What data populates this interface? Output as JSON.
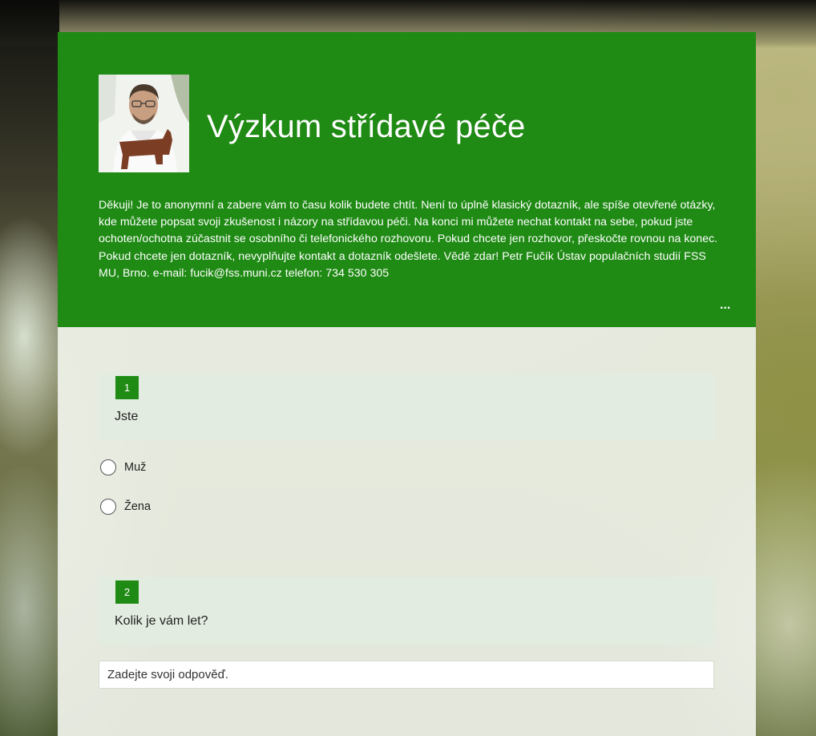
{
  "form": {
    "title": "Výzkum střídavé péče",
    "description": "Děkuji! Je to anonymní a zabere vám to času kolik budete chtít. Není to úplně klasický dotazník, ale spíše otevřené otázky, kde můžete popsat svoji zkušenost i názory na střídavou péči. Na konci mi můžete nechat kontakt na sebe, pokud jste ochoten/ochotna zúčastnit se osobního či telefonického rozhovoru. Pokud chcete jen rozhovor, přeskočte rovnou na konec. Pokud chcete jen dotazník, nevyplňujte kontakt a dotazník odešlete. Vědě zdar! Petr Fučík Ústav populačních studií FSS MU, Brno. e-mail: fucik@fss.muni.cz telefon: 734 530 305",
    "more_label": "...",
    "accent_color": "#1f8a14"
  },
  "questions": [
    {
      "number": "1",
      "title": "Jste",
      "options": [
        "Muž",
        "Žena"
      ]
    },
    {
      "number": "2",
      "title": "Kolik je vám let?",
      "placeholder": "Zadejte svoji odpověď."
    }
  ]
}
